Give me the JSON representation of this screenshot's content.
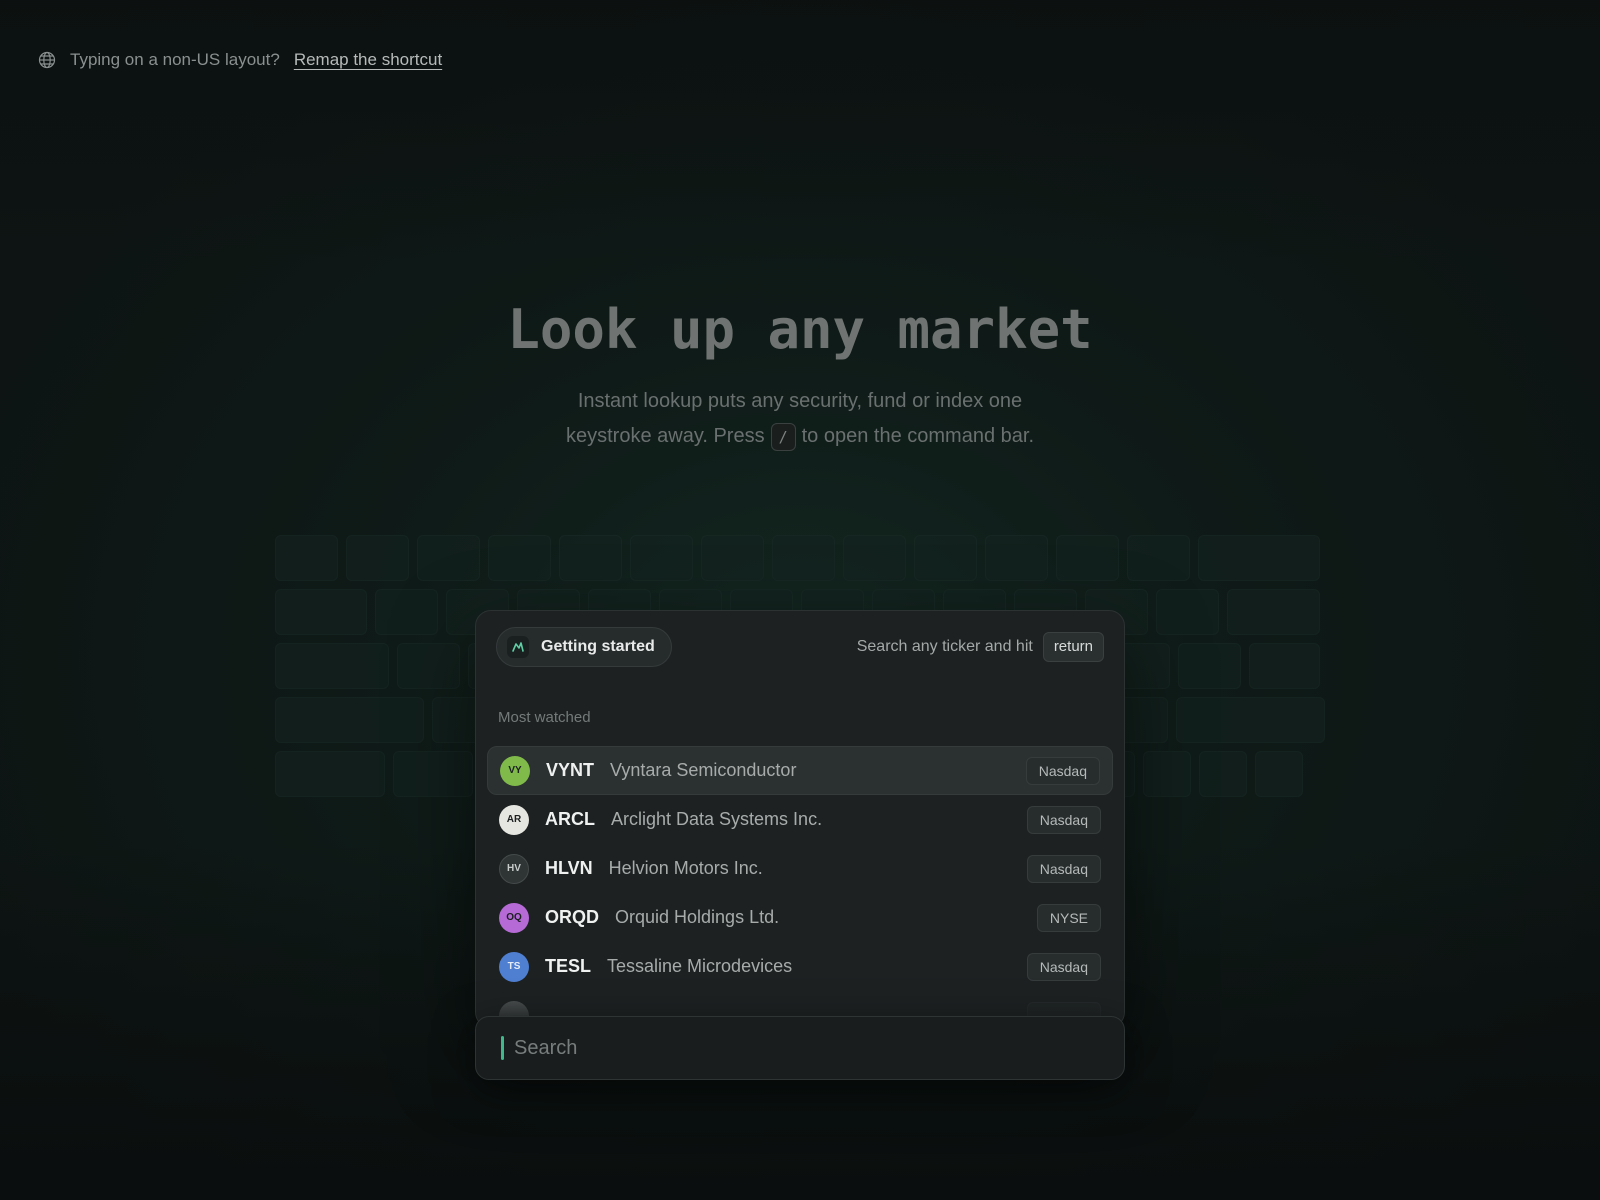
{
  "notice": {
    "question": "Typing on a non-US layout?",
    "link": "Remap the shortcut",
    "icon": "globe-icon"
  },
  "hero": {
    "title": "Look up any market",
    "subtitle_line1": "Instant lookup puts any security, fund or index one",
    "subtitle_line2_before": "keystroke away. Press",
    "shortcut_key": "/",
    "subtitle_line2_after": "to open the command bar."
  },
  "panel": {
    "chip_label": "Getting started",
    "hint_text": "Search any ticker and hit",
    "hint_key": "return",
    "section_label": "Most watched",
    "items": [
      {
        "initials": "VY",
        "ticker": "VYNT",
        "company": "Vyntara Semiconductor",
        "exchange": "Nasdaq",
        "color": "#7fba4a"
      },
      {
        "initials": "AR",
        "ticker": "ARCL",
        "company": "Arclight Data Systems Inc.",
        "exchange": "Nasdaq",
        "color": "#e6e6e0"
      },
      {
        "initials": "HV",
        "ticker": "HLVN",
        "company": "Helvion Motors Inc.",
        "exchange": "Nasdaq",
        "color": "#2f3435"
      },
      {
        "initials": "OQ",
        "ticker": "ORQD",
        "company": "Orquid Holdings Ltd.",
        "exchange": "NYSE",
        "color": "#b56ad6"
      },
      {
        "initials": "TS",
        "ticker": "TESL",
        "company": "Tessaline Microdevices",
        "exchange": "Nasdaq",
        "color": "#4f7fd1"
      }
    ]
  },
  "search": {
    "placeholder": "Search"
  }
}
